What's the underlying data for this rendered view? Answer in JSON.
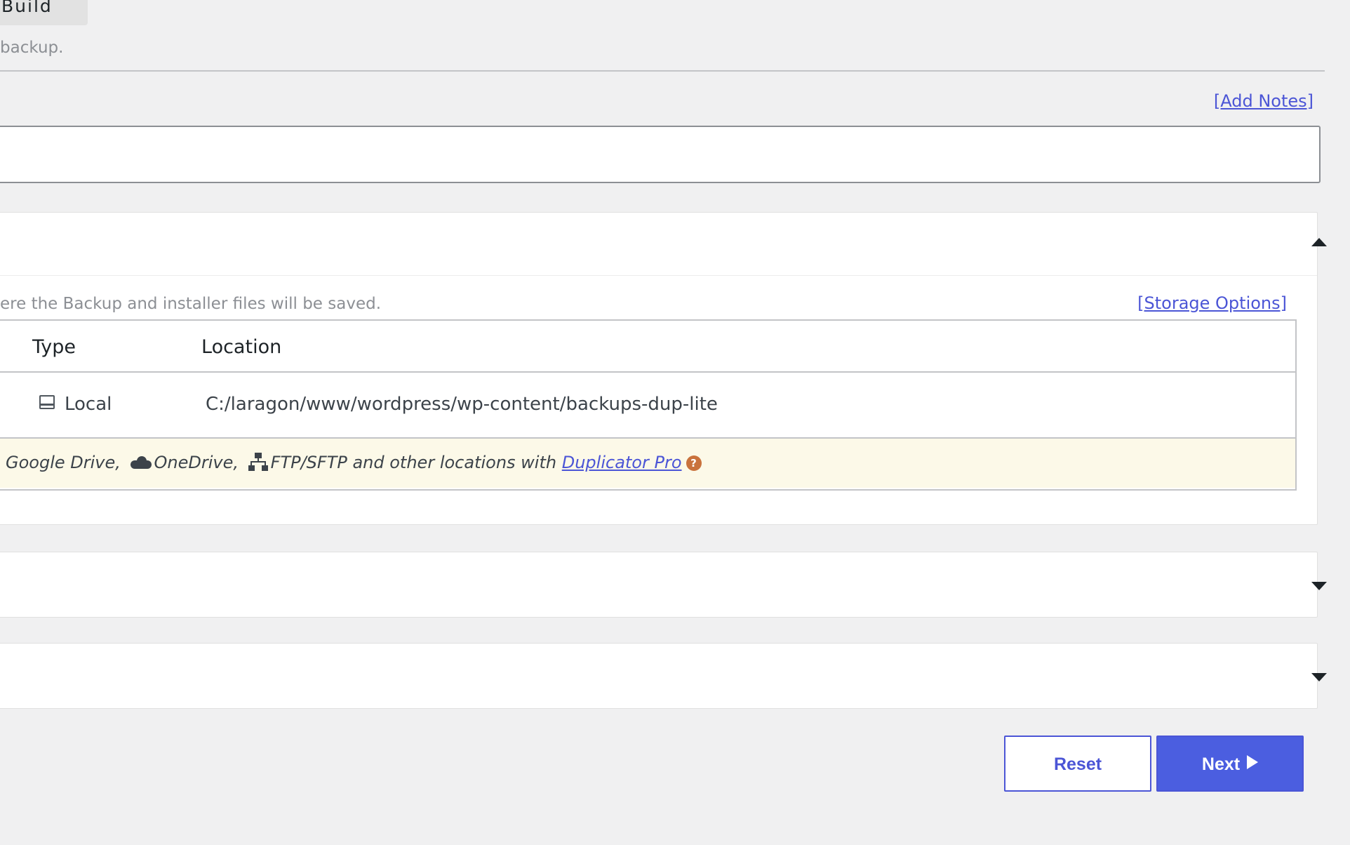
{
  "header": {
    "step_tab_label": "Build",
    "subtitle": "backup."
  },
  "notes": {
    "add_notes_link": "[Add Notes]",
    "value": ""
  },
  "storage": {
    "description": "ere the Backup and installer files will be saved.",
    "options_link": "[Storage Options]",
    "table": {
      "columns": [
        "Type",
        "Location"
      ],
      "rows": [
        {
          "type": "Local",
          "type_icon": "drive-icon",
          "location": "C:/laragon/www/wordpress/wp-content/backups-dup-lite"
        }
      ]
    },
    "promo": {
      "text_1": "Google Drive,",
      "icon_2": "cloud-icon",
      "text_2": "OneDrive,",
      "icon_3": "network-icon",
      "text_3": "FTP/SFTP and other locations with",
      "link": "Duplicator Pro",
      "help_icon": "?"
    }
  },
  "actions": {
    "reset_label": "Reset",
    "next_label": "Next"
  },
  "colors": {
    "accent": "#4b55d6",
    "background": "#f0f0f1",
    "promo_bg": "#fcf9e8",
    "help_badge": "#c9723c"
  }
}
